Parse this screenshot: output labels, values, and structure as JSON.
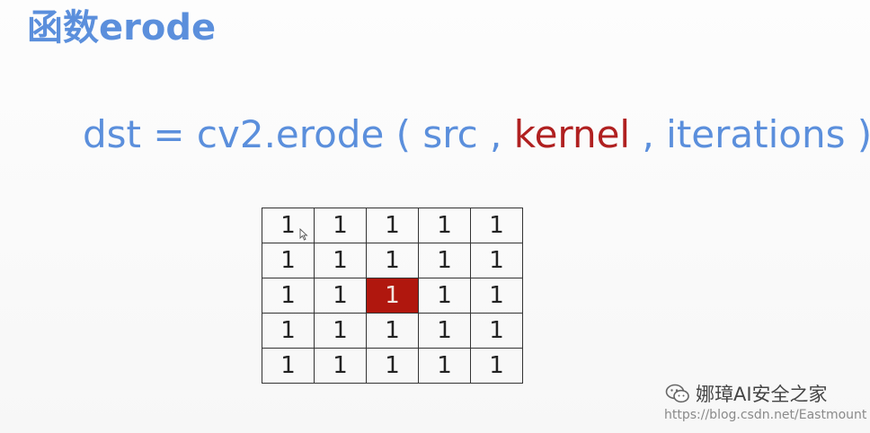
{
  "slide": {
    "title": "函数erode",
    "formula": {
      "prefix": "dst = cv2.erode ( src , ",
      "kernel": "kernel",
      "suffix": " , iterations )"
    },
    "kernel_grid": {
      "rows": [
        [
          "1",
          "1",
          "1",
          "1",
          "1"
        ],
        [
          "1",
          "1",
          "1",
          "1",
          "1"
        ],
        [
          "1",
          "1",
          "1",
          "1",
          "1"
        ],
        [
          "1",
          "1",
          "1",
          "1",
          "1"
        ],
        [
          "1",
          "1",
          "1",
          "1",
          "1"
        ]
      ],
      "highlight_cell": {
        "row": 2,
        "col": 2
      },
      "highlight_color": "#b0170e"
    },
    "colors": {
      "title": "#5b8fdc",
      "formula": "#5b8fdc",
      "keyword": "#b02020"
    }
  },
  "watermark": {
    "icon": "wechat-icon",
    "name": "娜璋AI安全之家",
    "url": "https://blog.csdn.net/Eastmount"
  }
}
